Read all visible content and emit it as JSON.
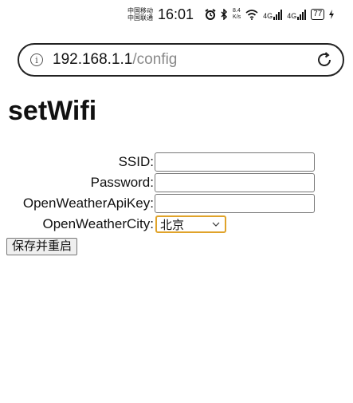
{
  "status_bar": {
    "carrier1": "中国移动",
    "carrier2": "中国联通",
    "time": "16:01",
    "speed_value": "8.4",
    "speed_unit": "K/s",
    "signal1": "4G",
    "signal2": "4G",
    "battery": "77"
  },
  "browser": {
    "url_host": "192.168.1.1",
    "url_path": "/config"
  },
  "page": {
    "title": "setWifi",
    "form": {
      "ssid_label": "SSID:",
      "password_label": "Password:",
      "apikey_label": "OpenWeatherApiKey:",
      "city_label": "OpenWeatherCity:",
      "city_selected": "北京",
      "submit_label": "保存并重启"
    }
  }
}
